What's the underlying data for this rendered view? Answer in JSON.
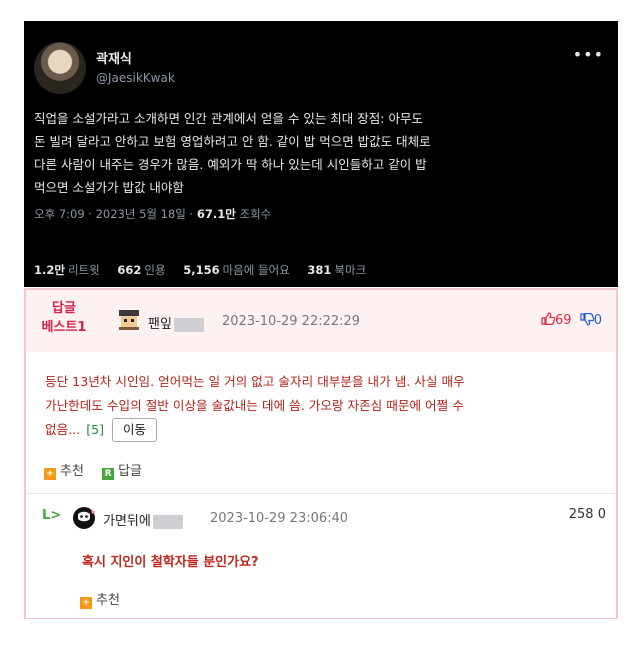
{
  "tweet": {
    "display_name": "곽재식",
    "handle": "@JaesikKwak",
    "more_icon": "more-icon",
    "body_lines": [
      "직업을 소설가라고 소개하면 인간 관계에서 얻을 수 있는 최대 장점: 아무도",
      "돈 빌려 달라고 안하고 보험 영업하려고 안 함. 같이 밥 먹으면 밥값도 대체로",
      "다른 사람이 내주는 경우가 많음. 예외가 딱 하나 있는데 시인들하고 같이 밥",
      "먹으면 소설가가 밥값 내야함"
    ],
    "time": "오후 7:09",
    "date": "2023년 5월 18일",
    "views_count": "67.1만",
    "views_label": "조회수",
    "stats": [
      {
        "count": "1.2만",
        "label": "리트윗"
      },
      {
        "count": "662",
        "label": "인용"
      },
      {
        "count": "5,156",
        "label": "마음에 들어요"
      },
      {
        "count": "381",
        "label": "북마크"
      }
    ]
  },
  "best_comment": {
    "badge_line1": "답글",
    "badge_line2": "베스트1",
    "username": "팬잎",
    "timestamp": "2023-10-29 22:22:29",
    "upvotes": "69",
    "downvotes": "0",
    "body_lines": [
      "등단 13년차 시인임. 얻어먹는 일 거의 없고 술자리 대부분을 내가 냄. 사실 매우",
      "가난한데도 수입의 절반 이상을 술값내는 데에 씀. 가오랑 자존심 때문에 어쩔 수",
      "없음..."
    ],
    "reply_count": "[5]",
    "move_label": "이동",
    "recommend_label": "추천",
    "reply_label": "답글"
  },
  "reply": {
    "username": "가면뒤에",
    "timestamp": "2023-10-29 23:06:40",
    "upvotes": "258",
    "downvotes": "0",
    "text": "혹시 지인이 철학자들 분인가요?",
    "recommend_label": "추천"
  },
  "colors": {
    "tweet_bg": "#000000",
    "best_bg": "#fdf1f2",
    "best_border": "#f2c8cd",
    "best_label": "#d4234a",
    "comment_text": "#b3251c",
    "upvote": "#e2233d",
    "downvote": "#1f57d6"
  }
}
